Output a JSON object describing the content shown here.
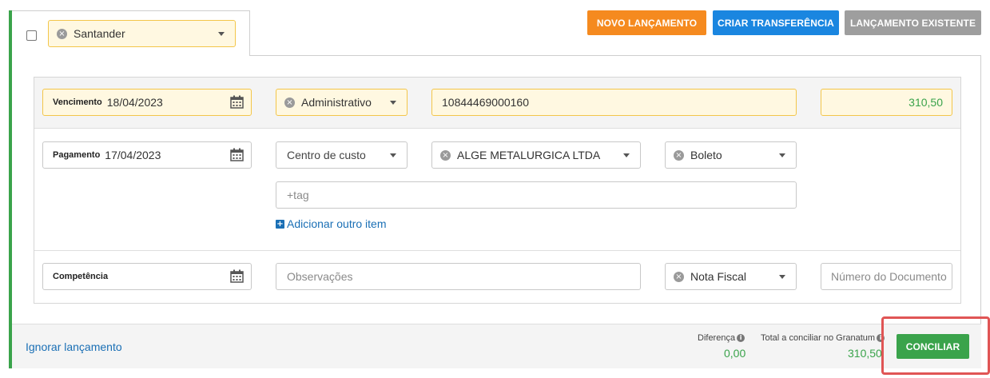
{
  "bank_selector": {
    "value": "Santander"
  },
  "toolbar": {
    "new_entry": "NOVO LANÇAMENTO",
    "create_transfer": "CRIAR TRANSFERÊNCIA",
    "existing_entry": "LANÇAMENTO EXISTENTE"
  },
  "row1": {
    "due_label": "Vencimento",
    "due_date": "18/04/2023",
    "category": "Administrativo",
    "document_number": "10844469000160",
    "amount": "310,50"
  },
  "row2": {
    "payment_label": "Pagamento",
    "payment_date": "17/04/2023",
    "cost_center_placeholder": "Centro de custo",
    "supplier": "ALGE METALURGICA LTDA",
    "payment_method": "Boleto",
    "tag_placeholder": "+tag",
    "add_item": "Adicionar outro item"
  },
  "row3": {
    "competence_label": "Competência",
    "notes_placeholder": "Observações",
    "doc_type": "Nota Fiscal",
    "doc_number_placeholder": "Número do Documento"
  },
  "footer": {
    "ignore_link": "Ignorar lançamento",
    "difference_label": "Diferença",
    "difference_value": "0,00",
    "total_label": "Total a conciliar no Granatum",
    "total_value": "310,50",
    "reconcile_button": "CONCILIAR"
  },
  "colors": {
    "accent_green": "#3aa34b",
    "orange": "#f58a1f",
    "blue": "#1a86e0",
    "gray": "#9e9e9e",
    "highlight": "#fff8e1",
    "highlight_border": "#f3c64a"
  }
}
